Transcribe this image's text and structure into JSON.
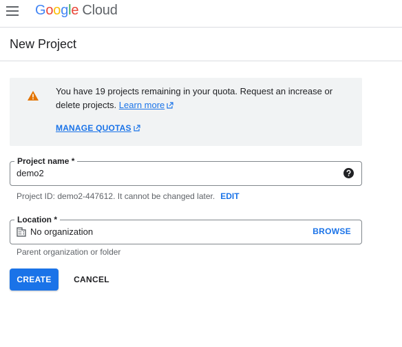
{
  "header": {
    "logo_letters": [
      "G",
      "o",
      "o",
      "g",
      "l",
      "e"
    ],
    "logo_product": "Cloud"
  },
  "page": {
    "title": "New Project"
  },
  "quota_notice": {
    "message": "You have 19 projects remaining in your quota. Request an increase or delete projects.",
    "learn_more_label": "Learn more",
    "manage_quotas_label": "MANAGE QUOTAS"
  },
  "project_name": {
    "label": "Project name *",
    "value": "demo2",
    "help_icon": "help-circle-icon"
  },
  "project_id": {
    "text": "Project ID: demo2-447612. It cannot be changed later.",
    "edit_label": "EDIT"
  },
  "location": {
    "label": "Location *",
    "value": "No organization",
    "browse_label": "BROWSE",
    "icon": "building-icon",
    "hint": "Parent organization or folder"
  },
  "actions": {
    "create_label": "CREATE",
    "cancel_label": "CANCEL"
  },
  "colors": {
    "accent": "#1a73e8",
    "warning": "#e37400",
    "notice_bg": "#f1f3f4"
  }
}
